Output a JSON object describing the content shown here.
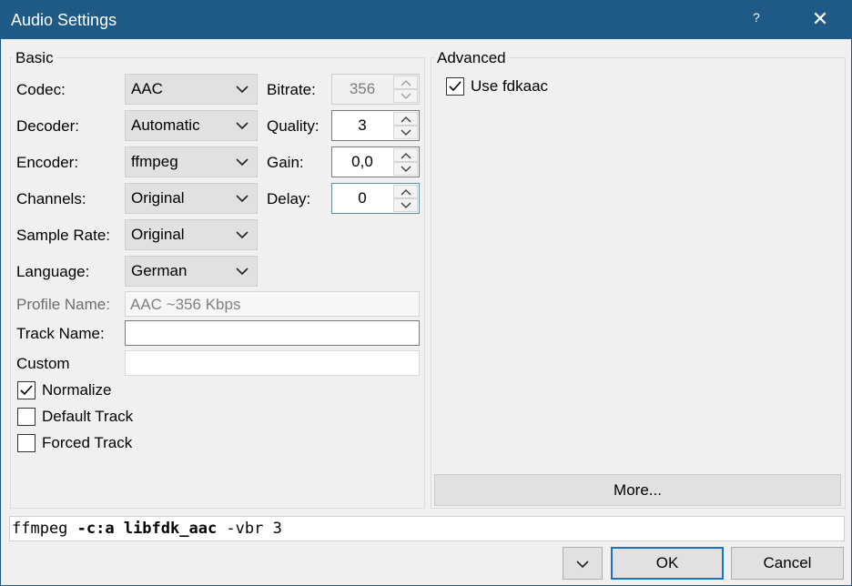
{
  "window": {
    "title": "Audio Settings",
    "help_label": "?",
    "close_label": "✕"
  },
  "basic": {
    "title": "Basic",
    "codec": {
      "label": "Codec:",
      "value": "AAC"
    },
    "decoder": {
      "label": "Decoder:",
      "value": "Automatic"
    },
    "encoder": {
      "label": "Encoder:",
      "value": "ffmpeg"
    },
    "channels": {
      "label": "Channels:",
      "value": "Original"
    },
    "sample_rate": {
      "label": "Sample Rate:",
      "value": "Original"
    },
    "language": {
      "label": "Language:",
      "value": "German"
    },
    "bitrate": {
      "label": "Bitrate:",
      "value": "356"
    },
    "quality": {
      "label": "Quality:",
      "value": "3"
    },
    "gain": {
      "label": "Gain:",
      "value": "0,0"
    },
    "delay": {
      "label": "Delay:",
      "value": "0"
    },
    "profile_name": {
      "label": "Profile Name:",
      "value": "AAC ~356 Kbps"
    },
    "track_name": {
      "label": "Track Name:",
      "value": ""
    },
    "custom": {
      "label": "Custom",
      "value": ""
    },
    "normalize": {
      "label": "Normalize",
      "checked": true
    },
    "default_track": {
      "label": "Default Track",
      "checked": false
    },
    "forced_track": {
      "label": "Forced Track",
      "checked": false
    }
  },
  "advanced": {
    "title": "Advanced",
    "use_fdkaac": {
      "label": "Use fdkaac",
      "checked": true
    },
    "more_label": "More..."
  },
  "command": {
    "part1": "ffmpeg ",
    "part2": "-c:a libfdk_aac",
    "part3": " -vbr 3"
  },
  "footer": {
    "ok_label": "OK",
    "cancel_label": "Cancel"
  },
  "icons": {
    "dropdown": "chevron-down-icon",
    "spin_up": "chevron-up-icon",
    "spin_down": "chevron-down-icon",
    "check": "checkmark-icon"
  },
  "colors": {
    "titlebar": "#1f5a86",
    "default_button_border": "#1a73c9"
  }
}
